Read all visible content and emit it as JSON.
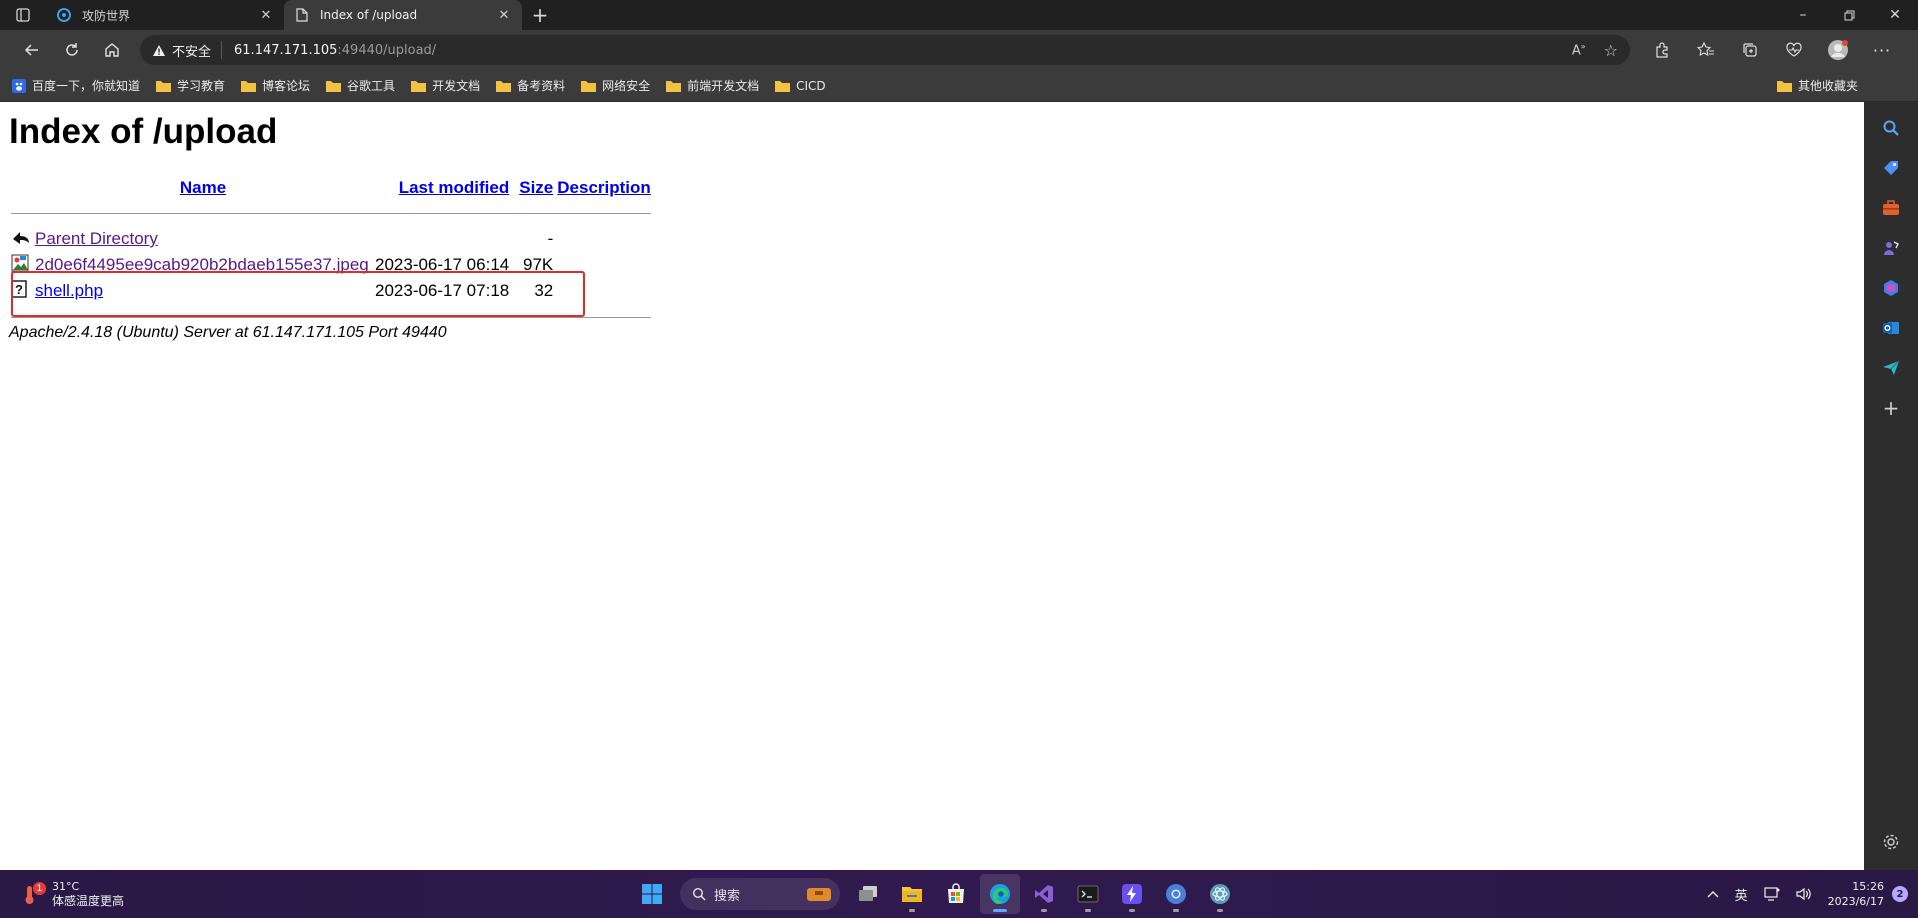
{
  "tabs": [
    {
      "title": "攻防世界",
      "icon": "xctf-icon"
    },
    {
      "title": "Index of /upload",
      "icon": "page-icon"
    }
  ],
  "toolbar": {
    "security_label": "不安全",
    "url_host": "61.147.171.105",
    "url_rest": ":49440/upload/"
  },
  "bookmarks": [
    {
      "label": "百度一下，你就知道",
      "icon": "baidu-icon"
    },
    {
      "label": "学习教育",
      "icon": "folder-icon"
    },
    {
      "label": "博客论坛",
      "icon": "folder-icon"
    },
    {
      "label": "谷歌工具",
      "icon": "folder-icon"
    },
    {
      "label": "开发文档",
      "icon": "folder-icon"
    },
    {
      "label": "备考资料",
      "icon": "folder-icon"
    },
    {
      "label": "网络安全",
      "icon": "folder-icon"
    },
    {
      "label": "前端开发文档",
      "icon": "folder-icon"
    },
    {
      "label": "CICD",
      "icon": "folder-icon"
    }
  ],
  "other_bookmarks": "其他收藏夹",
  "page": {
    "title": "Index of /upload",
    "columns": {
      "name": "Name",
      "modified": "Last modified",
      "size": "Size",
      "description": "Description"
    },
    "rows": [
      {
        "name": "Parent Directory",
        "modified": "",
        "size": "-",
        "description": "",
        "icon": "back-icon"
      },
      {
        "name": "2d0e6f4495ee9cab920b2bdaeb155e37.jpeg",
        "modified": "2023-06-17 06:14",
        "size": "97K",
        "description": "",
        "icon": "image-file-icon"
      },
      {
        "name": "shell.php",
        "modified": "2023-06-17 07:18",
        "size": "32",
        "description": "",
        "icon": "unknown-file-icon"
      }
    ],
    "footer": "Apache/2.4.18 (Ubuntu) Server at 61.147.171.105 Port 49440"
  },
  "taskbar": {
    "weather_temp": "31°C",
    "weather_desc": "体感温度更高",
    "weather_badge": "1",
    "search_label": "搜索",
    "ime": "英",
    "time": "15:26",
    "date": "2023/6/17",
    "notifications": "2"
  },
  "colors": {
    "highlight": "#e12b2b",
    "link": "#0000ee",
    "visited": "#551a8b"
  }
}
